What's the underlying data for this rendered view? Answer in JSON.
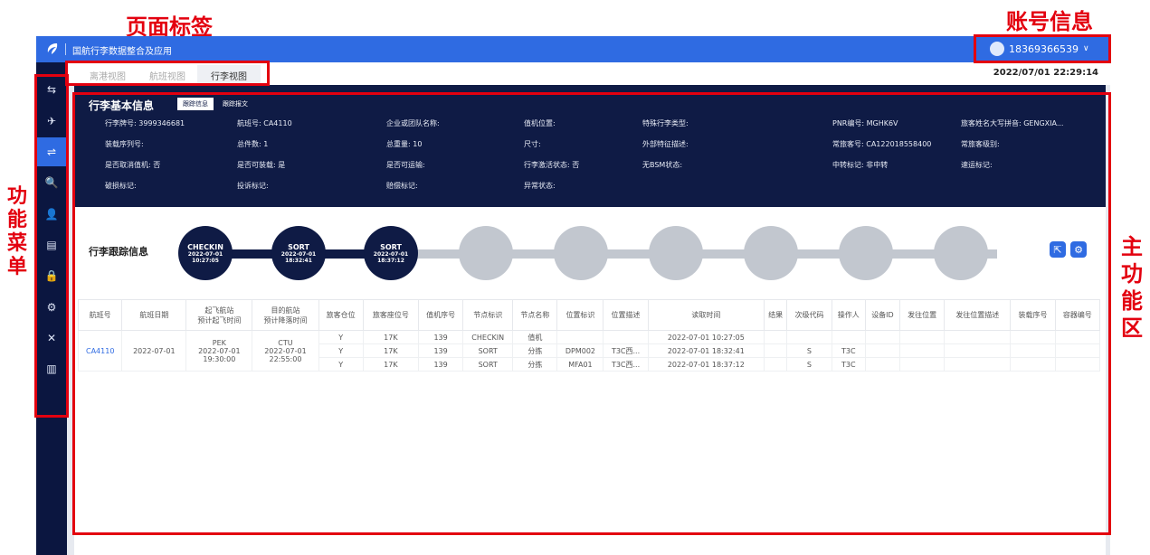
{
  "annotations": {
    "page_tabs": "页面标签",
    "account_info": "账号信息",
    "function_menu": [
      "功",
      "能",
      "菜",
      "单"
    ],
    "main_area": [
      "主",
      "功",
      "能",
      "区"
    ]
  },
  "header": {
    "app_title": "国航行李数据整合及应用",
    "account": "18369366539",
    "logo_icon": "airline-logo-icon",
    "caret_icon": "chevron-down-icon"
  },
  "sidebar": {
    "items": [
      {
        "icon": "swap-icon",
        "glyph": "⇆"
      },
      {
        "icon": "departure-icon",
        "glyph": "✈"
      },
      {
        "icon": "transit-icon",
        "glyph": "⇌"
      },
      {
        "icon": "search-icon",
        "glyph": "🔍"
      },
      {
        "icon": "user-icon",
        "glyph": "👤"
      },
      {
        "icon": "card-icon",
        "glyph": "▤"
      },
      {
        "icon": "lock-icon",
        "glyph": "🔒"
      },
      {
        "icon": "gear-icon",
        "glyph": "⚙"
      },
      {
        "icon": "tools-icon",
        "glyph": "✕"
      },
      {
        "icon": "chart-icon",
        "glyph": "▥"
      }
    ],
    "active_index": 2
  },
  "tabs": [
    {
      "label": "离港视图",
      "active": false
    },
    {
      "label": "航班视图",
      "active": false
    },
    {
      "label": "行李视图",
      "active": true
    }
  ],
  "datetime": "2022/07/01 22:29:14",
  "info": {
    "title": "行李基本信息",
    "tabs": [
      "跟踪信息",
      "跟踪报文"
    ],
    "row1": [
      "行李牌号: 3999346681",
      "航班号: CA4110",
      "企业或团队名称:",
      "值机位置:",
      "特殊行李类型:",
      "PNR编号: MGHK6V",
      "旅客姓名大写拼音: GENGXIA..."
    ],
    "row2": [
      "装载序列号:",
      "总件数: 1",
      "总重量: 10",
      "尺寸:",
      "外部特征描述:",
      "常旅客号: CA122018558400",
      "常旅客级别:"
    ],
    "row3": [
      "是否取消值机: 否",
      "是否可装载: 是",
      "是否可运输:",
      "行李激活状态: 否",
      "无BSM状态:",
      "中转标记: 非中转",
      "速运标记:"
    ],
    "row4": [
      "破损标记:",
      "投诉标记:",
      "赔偿标记:",
      "异常状态:"
    ]
  },
  "tracking": {
    "title": "行李跟踪信息",
    "nodes": [
      {
        "code": "CHECKIN",
        "date": "2022-07-01",
        "time": "10:27:05"
      },
      {
        "code": "SORT",
        "date": "2022-07-01",
        "time": "18:32:41"
      },
      {
        "code": "SORT",
        "date": "2022-07-01",
        "time": "18:37:12"
      }
    ],
    "pending_nodes": 6,
    "buttons": [
      {
        "icon": "export-icon",
        "glyph": "⇱"
      },
      {
        "icon": "settings-icon",
        "glyph": "⚙"
      }
    ]
  },
  "table": {
    "columns": [
      "航班号",
      "航班日期",
      "起飞航站\n预计起飞时间",
      "目的航站\n预计降落时间",
      "旅客仓位",
      "旅客座位号",
      "值机序号",
      "节点标识",
      "节点名称",
      "位置标识",
      "位置描述",
      "读取时间",
      "结果",
      "次级代码",
      "操作人",
      "设备ID",
      "发往位置",
      "发往位置描述",
      "装载序号",
      "容器编号"
    ],
    "group": {
      "flight": "CA4110",
      "date": "2022-07-01",
      "dep_station": "PEK",
      "dep_date": "2022-07-01",
      "dep_time": "19:30:00",
      "arr_station": "CTU",
      "arr_date": "2022-07-01",
      "arr_time": "22:55:00"
    },
    "rows": [
      {
        "cabin": "Y",
        "seat": "17K",
        "seq": "139",
        "node_id": "CHECKIN",
        "node_name": "值机",
        "loc_id": "",
        "loc_desc": "",
        "read_time": "2022-07-01 10:27:05",
        "result": "",
        "sub_code": "",
        "operator": ""
      },
      {
        "cabin": "Y",
        "seat": "17K",
        "seq": "139",
        "node_id": "SORT",
        "node_name": "分拣",
        "loc_id": "DPM002",
        "loc_desc": "T3C西...",
        "read_time": "2022-07-01 18:32:41",
        "result": "",
        "sub_code": "S",
        "operator": "T3C"
      },
      {
        "cabin": "Y",
        "seat": "17K",
        "seq": "139",
        "node_id": "SORT",
        "node_name": "分拣",
        "loc_id": "MFA01",
        "loc_desc": "T3C西...",
        "read_time": "2022-07-01 18:37:12",
        "result": "",
        "sub_code": "S",
        "operator": "T3C"
      }
    ]
  },
  "colors": {
    "brand_blue": "#2f6be2",
    "navy": "#0f1b45",
    "sidebar": "#0b1640",
    "annotation_red": "#e3000f",
    "pending_node": "#c2c7cf"
  }
}
